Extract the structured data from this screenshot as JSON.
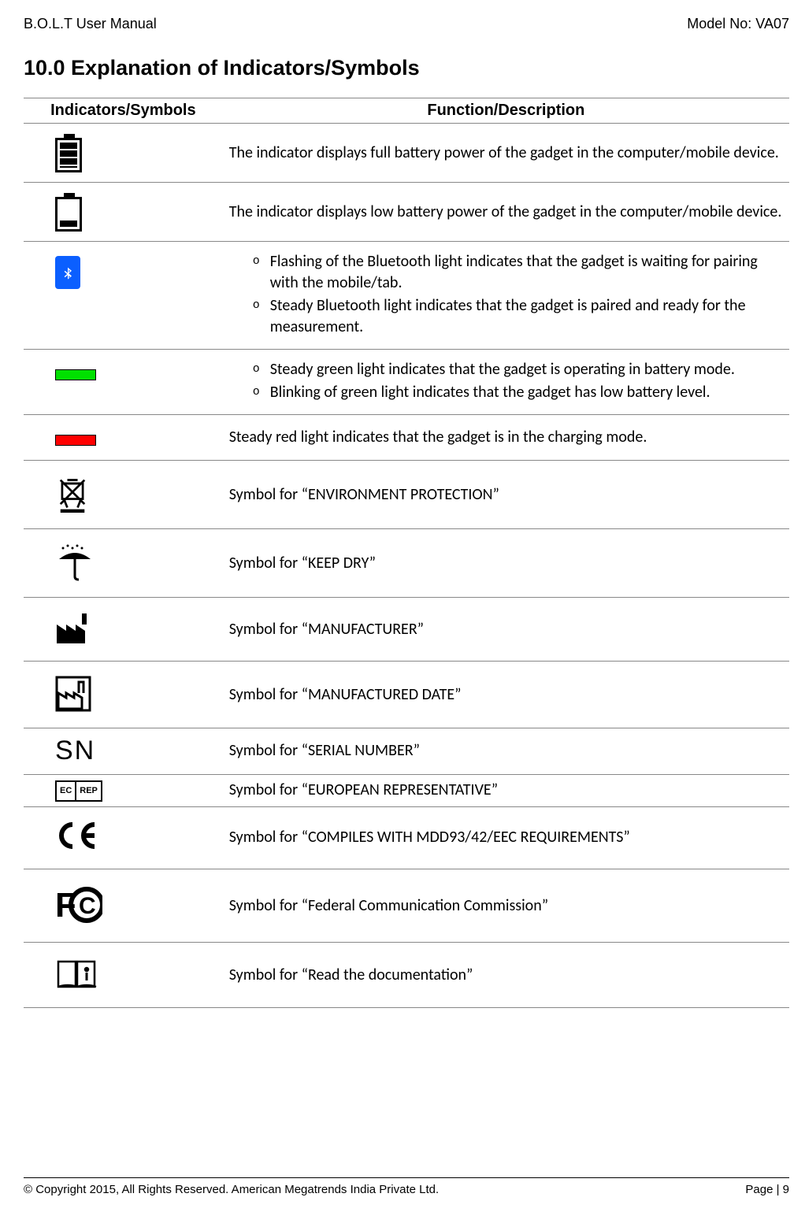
{
  "header": {
    "left": "B.O.L.T User Manual",
    "right": "Model No: VA07"
  },
  "title": "10.0 Explanation of Indicators/Symbols",
  "table": {
    "head": {
      "c1": "Indicators/Symbols",
      "c2": "Function/Description"
    },
    "rows": [
      {
        "icon": "battery-full",
        "desc": "The indicator displays full battery power of the gadget in the computer/mobile device."
      },
      {
        "icon": "battery-low",
        "desc": "The indicator displays low battery power of the gadget in the computer/mobile device."
      },
      {
        "icon": "bluetooth",
        "bullets": [
          "Flashing of the Bluetooth light indicates that the gadget is waiting for pairing with the mobile/tab.",
          "Steady Bluetooth light indicates that the gadget is paired and ready for the measurement."
        ]
      },
      {
        "icon": "green-led",
        "bullets": [
          "Steady green light indicates that the gadget is operating in battery mode.",
          "Blinking of green light indicates that the gadget has low battery level."
        ]
      },
      {
        "icon": "red-led",
        "desc": "Steady red light indicates that the gadget is in the charging mode."
      },
      {
        "icon": "weee",
        "desc": "Symbol for “ENVIRONMENT PROTECTION”"
      },
      {
        "icon": "keep-dry",
        "desc": "Symbol for “KEEP DRY”"
      },
      {
        "icon": "manufacturer",
        "desc": "Symbol for “MANUFACTURER”"
      },
      {
        "icon": "mfg-date",
        "desc": "Symbol for “MANUFACTURED DATE”"
      },
      {
        "icon": "serial-number",
        "sn_text": "SN",
        "desc": "Symbol for “SERIAL NUMBER”"
      },
      {
        "icon": "ec-rep",
        "ec": "EC",
        "rep": "REP",
        "desc": "Symbol for “EUROPEAN REPRESENTATIVE”"
      },
      {
        "icon": "ce-mark",
        "ce_text": "CЄ",
        "desc": "Symbol for “COMPILES WITH MDD93/42/EEC REQUIREMENTS”"
      },
      {
        "icon": "fcc",
        "desc": "Symbol for “Federal Communication Commission”"
      },
      {
        "icon": "read-doc",
        "desc": "Symbol for “Read the documentation”"
      }
    ]
  },
  "footer": {
    "left": "© Copyright 2015, All Rights Reserved. American Megatrends India Private Ltd.",
    "right": "Page | 9"
  }
}
